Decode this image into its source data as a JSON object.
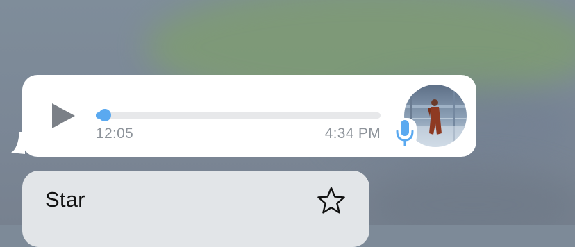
{
  "voice_message": {
    "duration": "12:05",
    "timestamp": "4:34 PM",
    "progress_fraction": 0.02,
    "play_icon": "play-icon",
    "mic_icon": "microphone-icon",
    "accent_color": "#5aa9f0"
  },
  "context_menu": {
    "items": [
      {
        "label": "Star",
        "icon": "star-icon"
      }
    ]
  }
}
